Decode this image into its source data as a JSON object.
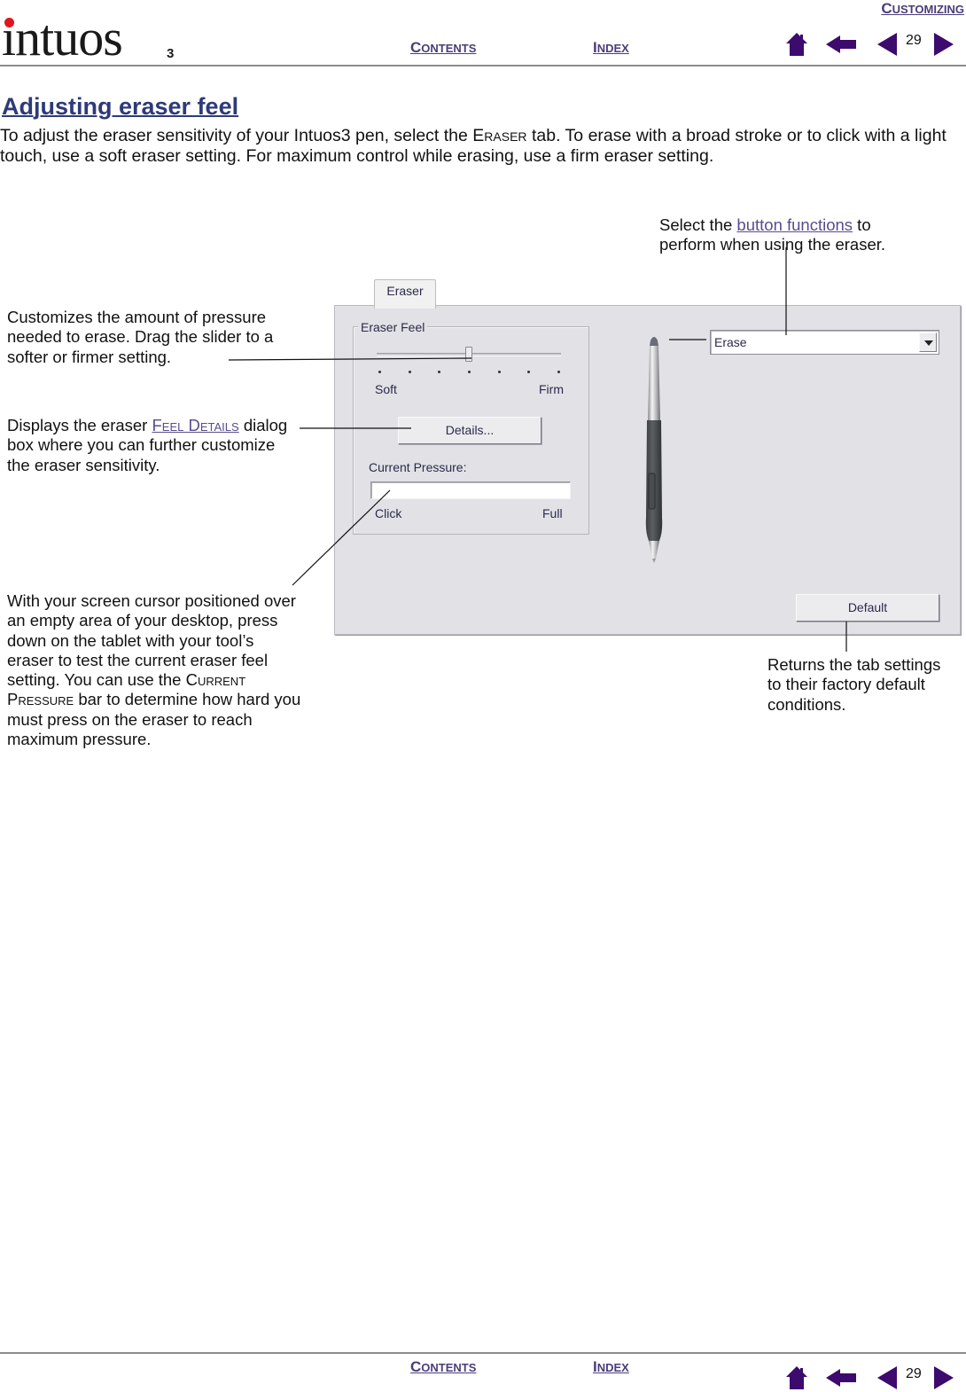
{
  "header": {
    "logo": {
      "name": "intuos",
      "suffix": "3"
    },
    "section_link": {
      "cap": "C",
      "rest": "ustomizing"
    },
    "contents_link": {
      "cap": "C",
      "rest": "ontents"
    },
    "index_link": {
      "cap": "I",
      "rest": "ndex"
    },
    "page_number": "29",
    "icons": [
      "home-icon",
      "back-icon",
      "previous-page-icon",
      "next-page-icon"
    ]
  },
  "footer": {
    "contents_link": {
      "cap": "C",
      "rest": "ontents"
    },
    "index_link": {
      "cap": "I",
      "rest": "ndex"
    },
    "page_number": "29"
  },
  "colors": {
    "nav_link": "#4b3d7a",
    "nav_icon": "#3d0a6e",
    "title": "#2e3a78",
    "inline_link": "#5a4c8e",
    "logo_dot": "#e3141b",
    "dialog_bg": "#e1e1e6"
  },
  "content": {
    "title": "Adjusting eraser feel",
    "intro": {
      "before": "To adjust the eraser sensitivity of your Intuos3 pen, select the ",
      "smallcaps": "Eraser",
      "after": " tab.  To erase with a broad stroke or to click with a light touch, use a soft eraser setting.  For maximum control while erasing, use a firm eraser setting."
    },
    "callouts": {
      "button_functions": {
        "before": "Select the ",
        "link": "button functions",
        "after": " to perform when using the eraser."
      },
      "eraser_feel": "Customizes the amount of pressure needed to erase.  Drag the slider to a softer or firmer setting.",
      "feel_details": {
        "before": "Displays the eraser ",
        "link": "Feel Details",
        "after": " dialog box where you can further customize the eraser sensitivity."
      },
      "current_pressure": {
        "before": "With your screen cursor positioned over an empty area of your desktop, press down on the tablet with your tool’s eraser to test the current eraser feel setting.  You can use the ",
        "smallcaps": "Current Pressure",
        "after": " bar to determine how hard you must press on the eraser to reach maximum pressure."
      },
      "default": "Returns the tab settings to their factory default conditions."
    }
  },
  "dialog": {
    "tab_label": "Eraser",
    "group_label": "Eraser Feel",
    "slider": {
      "min_label": "Soft",
      "max_label": "Firm",
      "tick_count": 7,
      "value": 0.5
    },
    "details_button": "Details...",
    "pressure_label": "Current Pressure:",
    "pressure_bar": {
      "min_label": "Click",
      "max_label": "Full",
      "value": 0
    },
    "eraser_function_select": {
      "value": "Erase"
    },
    "default_button": "Default"
  }
}
